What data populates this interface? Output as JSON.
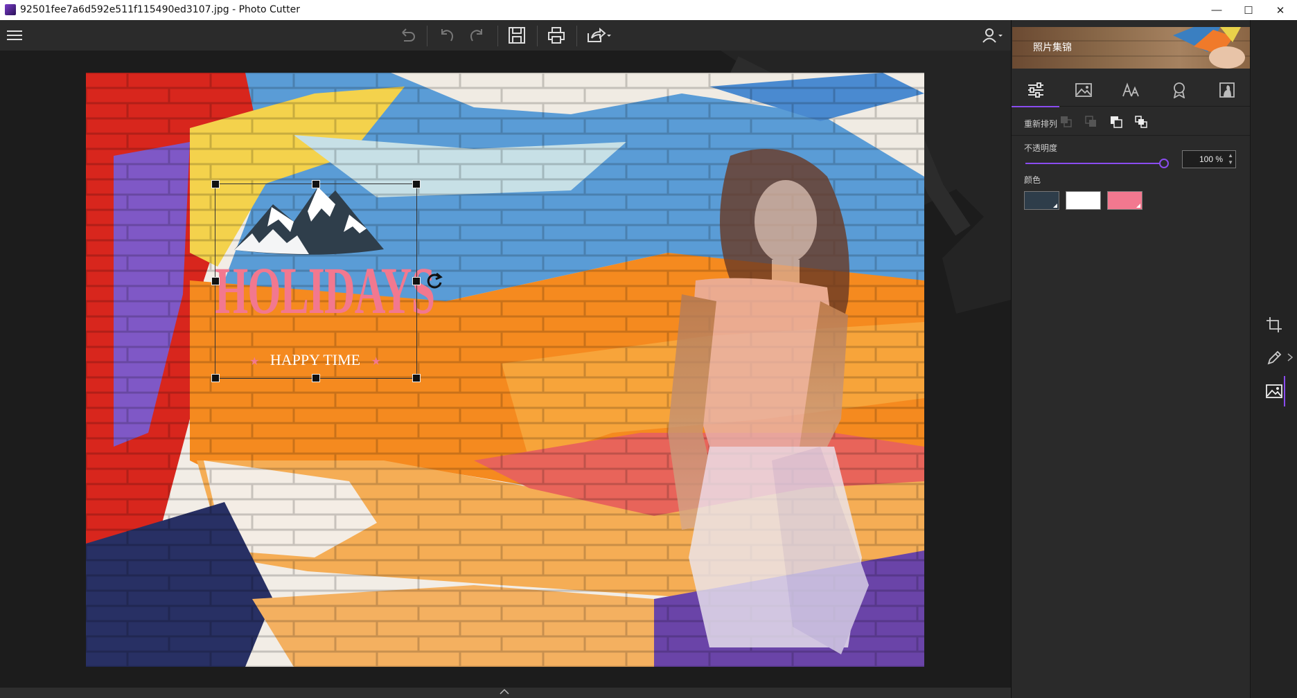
{
  "window": {
    "title": "92501fee7a6d592e511f115490ed3107.jpg - Photo Cutter",
    "minimize_glyph": "—",
    "maximize_glyph": "☐",
    "close_glyph": "✕"
  },
  "toolbar": {
    "icons": [
      "menu-icon",
      "reset-icon",
      "undo-icon",
      "redo-icon",
      "save-icon",
      "print-icon",
      "share-icon",
      "user-icon"
    ]
  },
  "canvas": {
    "sticker_title": "HOLIDAYS",
    "sticker_subtitle": "HAPPY TIME",
    "sticker_star": "★"
  },
  "panel": {
    "banner_text": "照片集锦",
    "tabs": [
      "adjust-icon",
      "image-icon",
      "text-icon",
      "badge-icon",
      "portrait-icon"
    ],
    "arrange_label": "重新排列",
    "opacity_label": "不透明度",
    "opacity_value": "100 %",
    "opacity_fraction": 1.0,
    "color_label": "颜色",
    "colors": [
      "#2e3d4a",
      "#ffffff",
      "#f2788f"
    ]
  },
  "side": {
    "icons": [
      "crop-icon",
      "pen-icon",
      "image-frame-icon"
    ]
  },
  "accent": "#8a4cf0"
}
